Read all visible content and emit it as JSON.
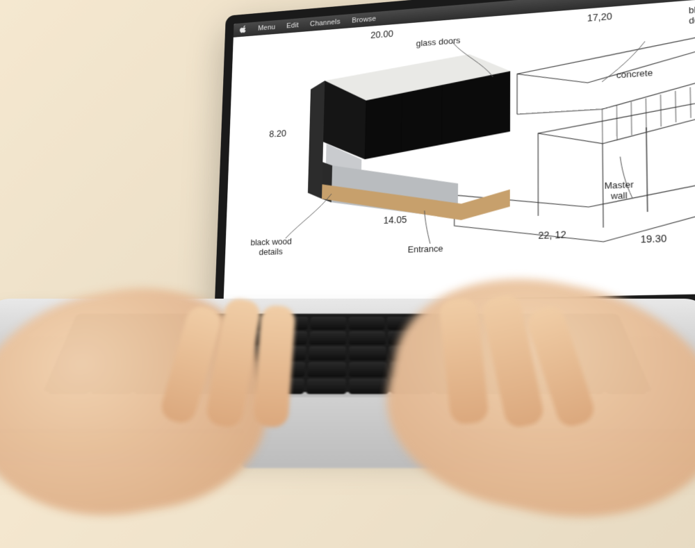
{
  "menubar": {
    "items": [
      "Menu",
      "Edit",
      "Channels",
      "Browse"
    ]
  },
  "drawing": {
    "dims": {
      "top_left": "20.00",
      "top_right": "17,20",
      "left": "8.20",
      "front": "14.05",
      "mid_right": "22, 12",
      "far_right": "19.30"
    },
    "labels": {
      "glass_doors": "glass doors",
      "concrete": "concrete",
      "black_wood": "black wood\ndetails",
      "black_truncated": "black\ndeta",
      "entrance": "Entrance",
      "master_wall": "Master\nwall"
    }
  }
}
